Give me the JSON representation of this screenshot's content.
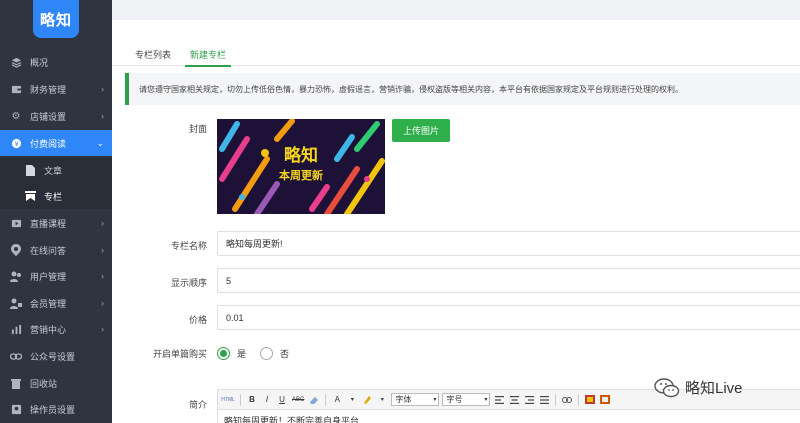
{
  "logo": {
    "text": "略知"
  },
  "sidebar": {
    "items": [
      {
        "label": "概况",
        "icon": "layers-icon",
        "has_children": false
      },
      {
        "label": "财务管理",
        "icon": "wallet-icon",
        "has_children": true
      },
      {
        "label": "店铺设置",
        "icon": "gear-icon",
        "has_children": true
      },
      {
        "label": "付费阅读",
        "icon": "coin-icon",
        "has_children": true,
        "expanded": true
      },
      {
        "label": "直播课程",
        "icon": "video-icon",
        "has_children": true
      },
      {
        "label": "在线问答",
        "icon": "pin-icon",
        "has_children": true
      },
      {
        "label": "用户管理",
        "icon": "users-icon",
        "has_children": true
      },
      {
        "label": "会员管理",
        "icon": "member-icon",
        "has_children": true
      },
      {
        "label": "营销中心",
        "icon": "chart-icon",
        "has_children": true
      },
      {
        "label": "公众号设置",
        "icon": "link-icon",
        "has_children": false
      },
      {
        "label": "回收站",
        "icon": "trash-icon",
        "has_children": false
      },
      {
        "label": "操作员设置",
        "icon": "operator-icon",
        "has_children": false
      }
    ],
    "sub_items": [
      {
        "label": "文章",
        "icon": "document-icon"
      },
      {
        "label": "专栏",
        "icon": "column-icon"
      }
    ]
  },
  "tabs": [
    {
      "label": "专栏列表"
    },
    {
      "label": "新建专栏"
    }
  ],
  "notice": "请您遵守国家相关规定，切勿上传低俗色情，暴力恐怖，虚假谣言，营销诈骗，侵权盗版等相关内容，本平台有依据国家规定及平台规则进行处理的权利。",
  "form": {
    "cover_label": "封面",
    "cover_image": {
      "title": "略知",
      "subtitle": "本周更新"
    },
    "upload_button": "上传图片",
    "name_label": "专栏名称",
    "name_value": "略知每周更新!",
    "order_label": "显示顺序",
    "order_value": "5",
    "price_label": "价格",
    "price_value": "0.01",
    "single_buy_label": "开启单篇购买",
    "single_buy_options": [
      {
        "label": "是",
        "checked": true
      },
      {
        "label": "否",
        "checked": false
      }
    ],
    "intro_label": "简介",
    "editor": {
      "toolbar": {
        "html_label": "HTML",
        "bold": "B",
        "italic": "I",
        "underline": "U",
        "strike": "ABC",
        "font_color": "A",
        "font_family": "字体",
        "font_size": "字号"
      },
      "content": "略知每周更新！不断完善自身平台"
    }
  },
  "watermark": {
    "text": "略知Live"
  },
  "colors": {
    "sidebar_bg": "#2f3440",
    "active_blue": "#2f86f6",
    "accent_green": "#2e9f4b",
    "upload_green": "#2fb04d"
  }
}
